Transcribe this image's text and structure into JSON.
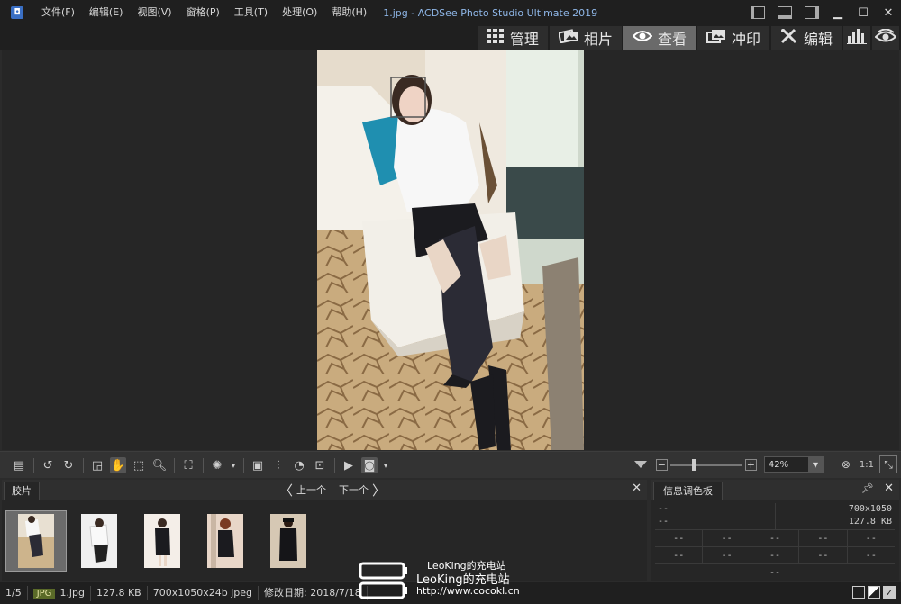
{
  "app": {
    "menu": [
      "文件(F)",
      "编辑(E)",
      "视图(V)",
      "窗格(P)",
      "工具(T)",
      "处理(O)",
      "帮助(H)"
    ],
    "title": "1.jpg - ACDSee Photo Studio Ultimate 2019"
  },
  "modes": [
    {
      "label": "管理",
      "icon": "grid-icon",
      "active": false
    },
    {
      "label": "相片",
      "icon": "photos-icon",
      "active": false
    },
    {
      "label": "查看",
      "icon": "eye-icon",
      "active": true
    },
    {
      "label": "冲印",
      "icon": "develop-icon",
      "active": false
    },
    {
      "label": "编辑",
      "icon": "edit-icon",
      "active": false
    }
  ],
  "zoom": {
    "value": "42%",
    "actual_size_label": "1:1",
    "slider_fraction": 0.3
  },
  "filmstrip": {
    "tab_label": "胶片",
    "prev_label": "上一个",
    "next_label": "下一个",
    "thumbnails": [
      {
        "name": "1.jpg",
        "selected": true
      },
      {
        "name": "2.jpg",
        "selected": false
      },
      {
        "name": "3.jpg",
        "selected": false
      },
      {
        "name": "4.jpg",
        "selected": false
      },
      {
        "name": "5.jpg",
        "selected": false
      }
    ]
  },
  "info_panel": {
    "tab_label": "信息调色板",
    "dimensions": "700x1050",
    "file_size": "127.8 KB",
    "left_top": "--",
    "left_bottom": "--",
    "dash": "--"
  },
  "status": {
    "index": "1/5",
    "format": "JPG",
    "filename": "1.jpg",
    "size": "127.8 KB",
    "details": "700x1050x24b jpeg",
    "modified": "修改日期: 2018/7/18"
  },
  "watermark": {
    "line1": "LeoKing的充电站",
    "line2": "LeoKing的充电站",
    "line3": "http://www.cocokl.cn"
  },
  "colors": {
    "accent": "#8fb7e8",
    "active_tab": "#6a6a6a",
    "jpg_badge": "#5a6a28"
  }
}
